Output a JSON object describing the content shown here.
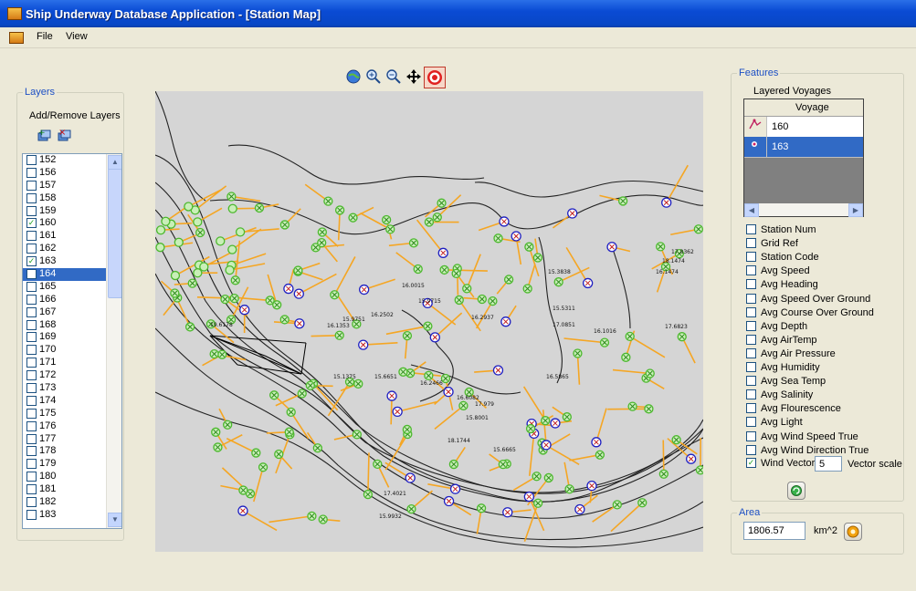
{
  "window": {
    "title": "Ship Underway Database Application - [Station Map]"
  },
  "menu": {
    "file": "File",
    "view": "View"
  },
  "layers": {
    "group_label": "Layers",
    "subtitle": "Add/Remove Layers",
    "items": [
      {
        "label": "152",
        "checked": false
      },
      {
        "label": "156",
        "checked": false
      },
      {
        "label": "157",
        "checked": false
      },
      {
        "label": "158",
        "checked": false
      },
      {
        "label": "159",
        "checked": false
      },
      {
        "label": "160",
        "checked": true
      },
      {
        "label": "161",
        "checked": false
      },
      {
        "label": "162",
        "checked": false
      },
      {
        "label": "163",
        "checked": true
      },
      {
        "label": "164",
        "checked": false,
        "selected": true
      },
      {
        "label": "165",
        "checked": false
      },
      {
        "label": "166",
        "checked": false
      },
      {
        "label": "167",
        "checked": false
      },
      {
        "label": "168",
        "checked": false
      },
      {
        "label": "169",
        "checked": false
      },
      {
        "label": "170",
        "checked": false
      },
      {
        "label": "171",
        "checked": false
      },
      {
        "label": "172",
        "checked": false
      },
      {
        "label": "173",
        "checked": false
      },
      {
        "label": "174",
        "checked": false
      },
      {
        "label": "175",
        "checked": false
      },
      {
        "label": "176",
        "checked": false
      },
      {
        "label": "177",
        "checked": false
      },
      {
        "label": "178",
        "checked": false
      },
      {
        "label": "179",
        "checked": false
      },
      {
        "label": "180",
        "checked": false
      },
      {
        "label": "181",
        "checked": false
      },
      {
        "label": "182",
        "checked": false
      },
      {
        "label": "183",
        "checked": false
      }
    ]
  },
  "features": {
    "group_label": "Features",
    "layered_voyages_label": "Layered Voyages",
    "grid_header": "Voyage",
    "voyages": [
      "160",
      "163"
    ],
    "checkboxes": [
      {
        "label": "Station Num",
        "checked": false
      },
      {
        "label": "Grid Ref",
        "checked": false
      },
      {
        "label": "Station Code",
        "checked": false
      },
      {
        "label": "Avg Speed",
        "checked": false
      },
      {
        "label": "Avg Heading",
        "checked": false
      },
      {
        "label": "Avg Speed Over Ground",
        "checked": false
      },
      {
        "label": "Avg Course Over Ground",
        "checked": false
      },
      {
        "label": "Avg Depth",
        "checked": false
      },
      {
        "label": "Avg AirTemp",
        "checked": false
      },
      {
        "label": "Avg Air Pressure",
        "checked": false
      },
      {
        "label": "Avg Humidity",
        "checked": false
      },
      {
        "label": "Avg Sea Temp",
        "checked": false
      },
      {
        "label": "Avg Salinity",
        "checked": false
      },
      {
        "label": "Avg Flourescence",
        "checked": false
      },
      {
        "label": "Avg Light",
        "checked": false
      },
      {
        "label": "Avg Wind Speed True",
        "checked": false
      },
      {
        "label": "Avg Wind Direction True",
        "checked": false
      }
    ],
    "wind_vector_label": "Wind Vector",
    "wind_vector_checked": true,
    "vector_scale_value": "5",
    "vector_scale_label": "Vector scale"
  },
  "area": {
    "group_label": "Area",
    "value": "1806.57",
    "unit": "km^2"
  },
  "map": {
    "labels": [
      "15.3838",
      "16.1474",
      "18.1474",
      "17.8362",
      "17.6823",
      "15.9715",
      "16.2937",
      "15.9751",
      "19.6178",
      "16.1353",
      "15.1375",
      "15.6651",
      "16.2466",
      "17.979",
      "16.6082",
      "15.8001",
      "17.4021",
      "15.9932",
      "15.6665",
      "18.1744",
      "16.0015",
      "16.2502",
      "15.5311",
      "17.0851",
      "16.1016",
      "16.5865"
    ]
  },
  "colors": {
    "titlebar": "#0a4bd4",
    "selection": "#316ac5",
    "vector": "#f5a623",
    "station_green": "#5ccc3a",
    "station_blue": "#2020c0"
  }
}
